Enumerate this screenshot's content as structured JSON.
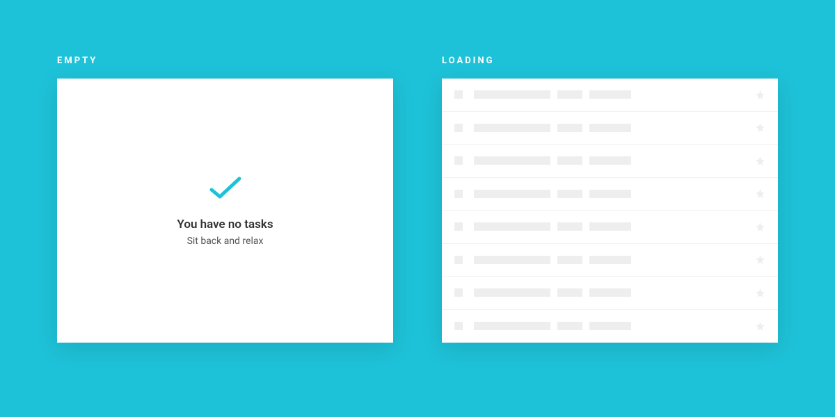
{
  "sections": {
    "empty": {
      "heading": "EMPTY",
      "title": "You have no tasks",
      "subtitle": "Sit back and relax"
    },
    "loading": {
      "heading": "LOADING"
    }
  },
  "colors": {
    "accent": "#1ec2d8",
    "skeleton": "#eeeeee"
  },
  "loading_row_count": 8
}
